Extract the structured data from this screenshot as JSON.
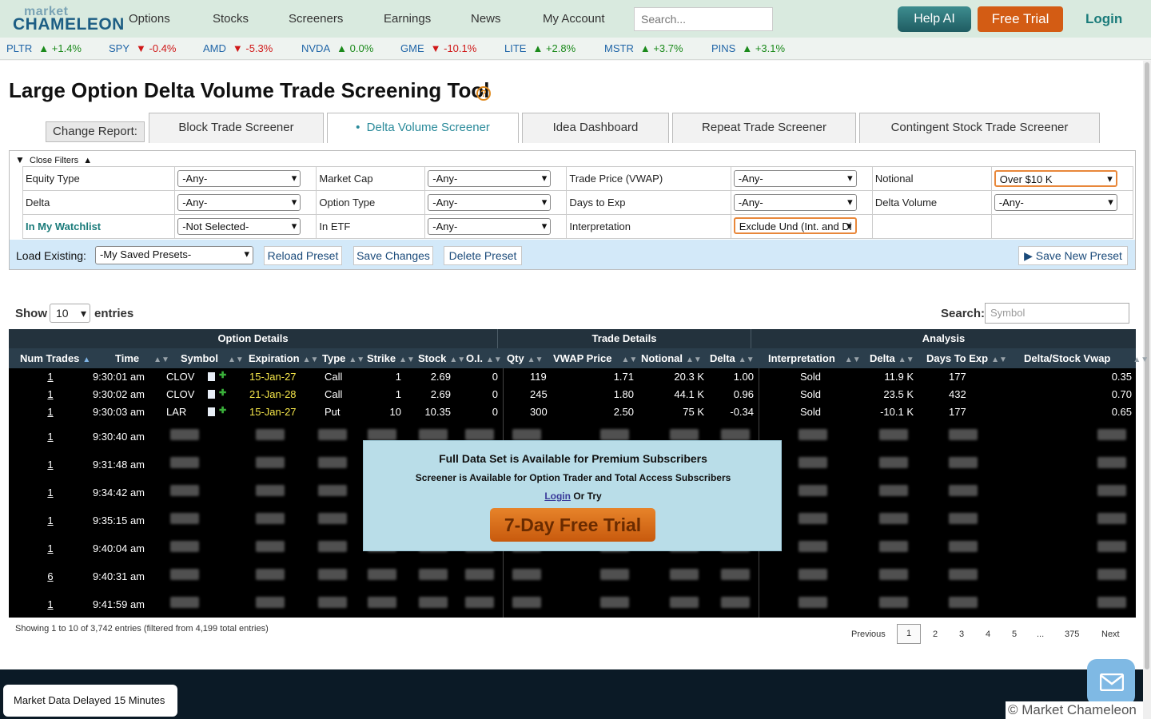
{
  "brand": {
    "line1": "market",
    "line2": "CHAMELEON"
  },
  "nav": {
    "items": [
      "Options",
      "Stocks",
      "Screeners",
      "Earnings",
      "News",
      "My Account"
    ],
    "search_placeholder": "Search...",
    "help_ai": "Help AI",
    "free_trial": "Free Trial",
    "login": "Login"
  },
  "ticker": [
    {
      "sym": "PLTR",
      "dir": "up",
      "arrow": "▲",
      "chg": "+1.4%"
    },
    {
      "sym": "SPY",
      "dir": "down",
      "arrow": "▼",
      "chg": "-0.4%"
    },
    {
      "sym": "AMD",
      "dir": "down",
      "arrow": "▼",
      "chg": "-5.3%"
    },
    {
      "sym": "NVDA",
      "dir": "up",
      "arrow": "▲",
      "chg": "0.0%"
    },
    {
      "sym": "GME",
      "dir": "down",
      "arrow": "▼",
      "chg": "-10.1%"
    },
    {
      "sym": "LITE",
      "dir": "up",
      "arrow": "▲",
      "chg": "+2.8%"
    },
    {
      "sym": "MSTR",
      "dir": "up",
      "arrow": "▲",
      "chg": "+3.7%"
    },
    {
      "sym": "PINS",
      "dir": "up",
      "arrow": "▲",
      "chg": "+3.1%"
    }
  ],
  "page": {
    "title": "Large Option Delta Volume Trade Screening Tool",
    "help": "?"
  },
  "tabs": {
    "change_report": "Change Report:",
    "items": [
      "Block Trade Screener",
      "Delta Volume Screener",
      "Idea Dashboard",
      "Repeat Trade Screener",
      "Contingent Stock Trade Screener"
    ],
    "active_bullet": "•"
  },
  "filters": {
    "toggle_label": "Close Filters",
    "toggle_arrow": "▲",
    "funnel": "▼",
    "equity_type": {
      "label": "Equity Type",
      "value": "-Any-"
    },
    "market_cap": {
      "label": "Market Cap",
      "value": "-Any-"
    },
    "trade_price": {
      "label": "Trade Price (VWAP)",
      "value": "-Any-"
    },
    "notional": {
      "label": "Notional",
      "value": "Over $10 K"
    },
    "delta": {
      "label": "Delta",
      "value": "-Any-"
    },
    "option_type": {
      "label": "Option Type",
      "value": "-Any-"
    },
    "days_to_exp": {
      "label": "Days to Exp",
      "value": "-Any-"
    },
    "delta_volume": {
      "label": "Delta Volume",
      "value": "-Any-"
    },
    "watchlist": {
      "label": "In My Watchlist",
      "value": "-Not Selected-"
    },
    "in_etf": {
      "label": "In ETF",
      "value": "-Any-"
    },
    "interpretation": {
      "label": "Interpretation",
      "value": "Exclude Und (Int. and Di"
    }
  },
  "presets": {
    "load_label": "Load Existing:",
    "selected": "-My Saved Presets-",
    "reload": "Reload Preset",
    "save": "Save Changes",
    "delete": "Delete Preset",
    "save_new": "Save New Preset",
    "save_new_arrow": "▶"
  },
  "table_controls": {
    "show": "Show",
    "entries_value": "10",
    "entries": "entries",
    "search_label": "Search:",
    "search_placeholder": "Symbol"
  },
  "groups": [
    "Option Details",
    "Trade Details",
    "Analysis"
  ],
  "columns": [
    "Num Trades",
    "Time",
    "Symbol",
    "Expiration",
    "Type",
    "Strike",
    "Stock",
    "O.I.",
    "Qty",
    "VWAP Price",
    "Notional",
    "Delta",
    "Interpretation",
    "Delta",
    "Days To Exp",
    "Delta/Stock Vwap"
  ],
  "sort_icon": "▲▼",
  "rows": [
    {
      "num": "1",
      "time": "9:30:01 am",
      "symbol": "CLOV",
      "expiration": "15-Jan-27",
      "type": "Call",
      "strike": "1",
      "stock": "2.69",
      "oi": "0",
      "qty": "119",
      "vwap": "1.71",
      "notional": "20.3 K",
      "delta": "1.00",
      "interp": "Sold",
      "delta2": "11.9 K",
      "dte": "177",
      "dsv": "0.35"
    },
    {
      "num": "1",
      "time": "9:30:02 am",
      "symbol": "CLOV",
      "expiration": "21-Jan-28",
      "type": "Call",
      "strike": "1",
      "stock": "2.69",
      "oi": "0",
      "qty": "245",
      "vwap": "1.80",
      "notional": "44.1 K",
      "delta": "0.96",
      "interp": "Sold",
      "delta2": "23.5 K",
      "dte": "432",
      "dsv": "0.70"
    },
    {
      "num": "1",
      "time": "9:30:03 am",
      "symbol": "LAR",
      "expiration": "15-Jan-27",
      "type": "Put",
      "strike": "10",
      "stock": "10.35",
      "oi": "0",
      "qty": "300",
      "vwap": "2.50",
      "notional": "75 K",
      "delta": "-0.34",
      "interp": "Sold",
      "delta2": "-10.1 K",
      "dte": "177",
      "dsv": "0.65"
    }
  ],
  "blurred_rows": [
    {
      "num": "1",
      "time": "9:30:40 am"
    },
    {
      "num": "1",
      "time": "9:31:48 am"
    },
    {
      "num": "1",
      "time": "9:34:42 am"
    },
    {
      "num": "1",
      "time": "9:35:15 am"
    },
    {
      "num": "1",
      "time": "9:40:04 am"
    },
    {
      "num": "6",
      "time": "9:40:31 am"
    },
    {
      "num": "1",
      "time": "9:41:59 am"
    }
  ],
  "overlay": {
    "title": "Full Data Set is Available for Premium Subscribers",
    "subtitle": "Screener is Available for Option Trader and Total Access Subscribers",
    "login": "Login",
    "or_try": "Or Try",
    "cta": "7-Day Free Trial"
  },
  "footer_info": {
    "showing": "Showing 1 to 10 of 3,742 entries (filtered from 4,199 total entries)",
    "pagination": [
      "Previous",
      "1",
      "2",
      "3",
      "4",
      "5",
      "...",
      "375",
      "Next"
    ]
  },
  "footer": {
    "delayed": "Market Data Delayed 15 Minutes",
    "copyright": "© Market Chameleon"
  },
  "colors": {
    "up": "#1b8a1b",
    "down": "#d01818",
    "accent": "#2a8a9a",
    "header": "#2b3e4c",
    "expiration": "#f5e64a",
    "cta": "#d35c14"
  }
}
